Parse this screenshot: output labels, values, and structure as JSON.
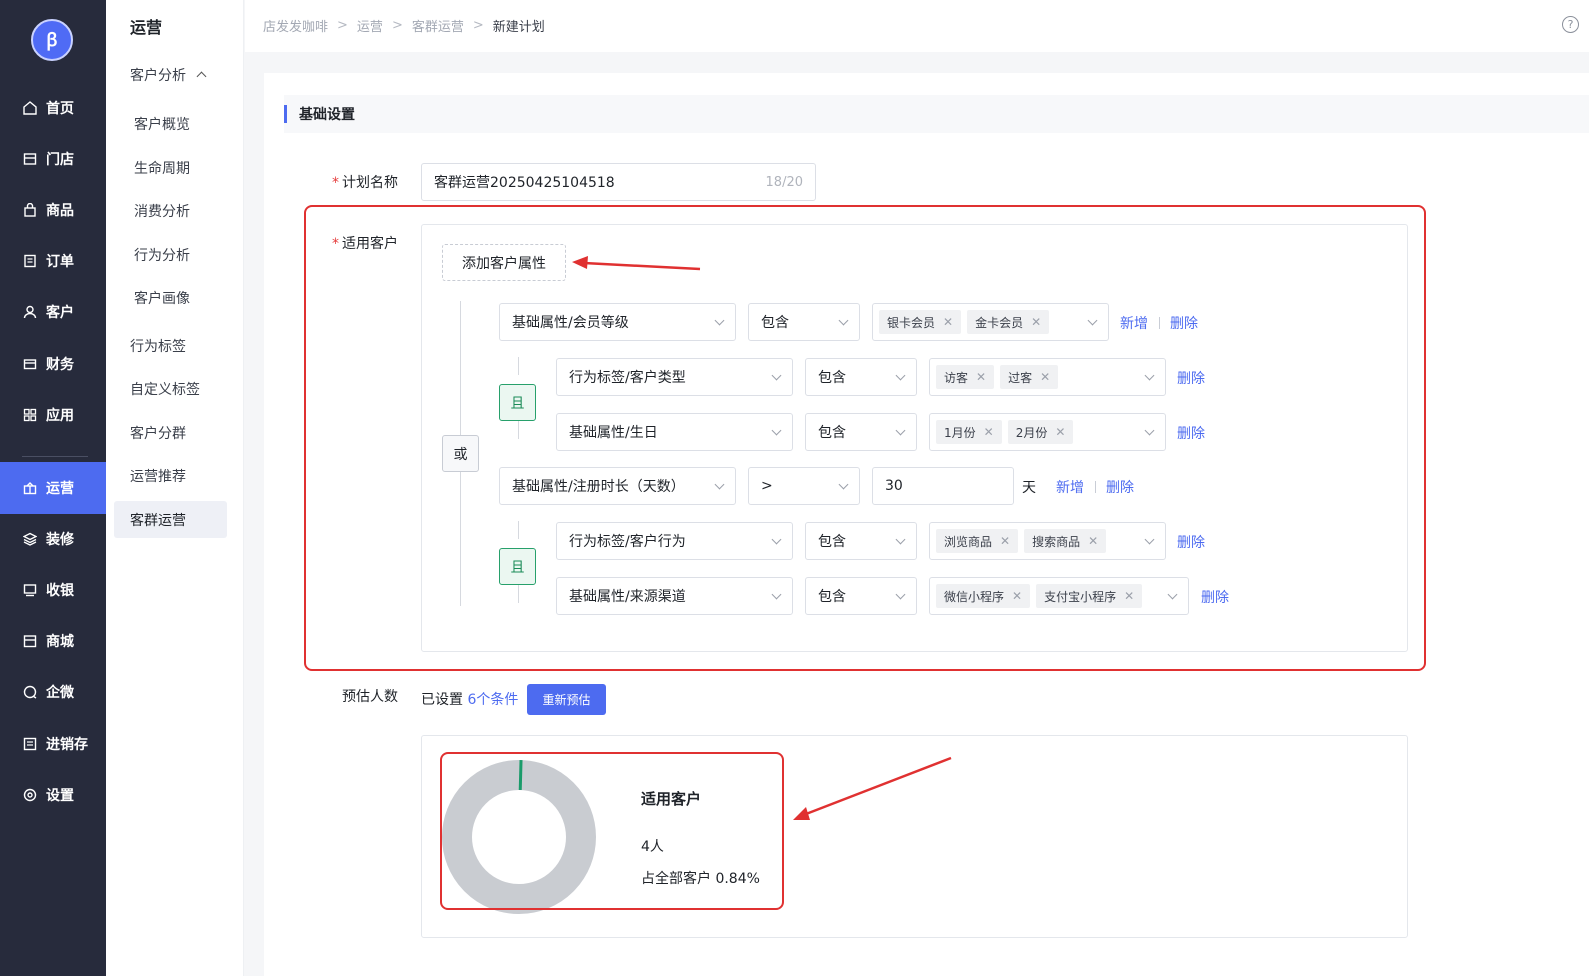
{
  "app": {
    "logo_text": "ꞵ"
  },
  "nav": {
    "items": [
      {
        "label": "首页",
        "icon": "home-icon"
      },
      {
        "label": "门店",
        "icon": "store-icon"
      },
      {
        "label": "商品",
        "icon": "bag-icon"
      },
      {
        "label": "订单",
        "icon": "order-icon"
      },
      {
        "label": "客户",
        "icon": "user-icon"
      },
      {
        "label": "财务",
        "icon": "wallet-icon"
      },
      {
        "label": "应用",
        "icon": "grid-icon"
      },
      {
        "label": "运营",
        "icon": "gift-icon"
      },
      {
        "label": "装修",
        "icon": "layers-icon"
      },
      {
        "label": "收银",
        "icon": "cashier-icon"
      },
      {
        "label": "商城",
        "icon": "mall-icon"
      },
      {
        "label": "企微",
        "icon": "chat-icon"
      },
      {
        "label": "进销存",
        "icon": "inventory-icon"
      },
      {
        "label": "设置",
        "icon": "gear-icon"
      }
    ]
  },
  "subnav": {
    "title": "运营",
    "group": "客户分析",
    "children": [
      "客户概览",
      "生命周期",
      "消费分析",
      "行为分析",
      "客户画像"
    ],
    "items": [
      "行为标签",
      "自定义标签",
      "客户分群",
      "运营推荐",
      "客群运营"
    ]
  },
  "breadcrumb": {
    "items": [
      "店发发咖啡",
      "运营",
      "客群运营"
    ],
    "current": "新建计划"
  },
  "section": {
    "title": "基础设置"
  },
  "form": {
    "plan_name_label": "计划名称",
    "plan_name_value": "客群运营20250425104518",
    "plan_name_counter": "18/20",
    "customers_label": "适用客户",
    "add_attr": "添加客户属性",
    "or_label": "或",
    "and_label": "且",
    "add_link": "新增",
    "delete_link": "删除",
    "day_unit": "天",
    "rows": {
      "r1": {
        "field": "基础属性/会员等级",
        "op": "包含",
        "tags": [
          "银卡会员",
          "金卡会员"
        ]
      },
      "r2": {
        "field": "行为标签/客户类型",
        "op": "包含",
        "tags": [
          "访客",
          "过客"
        ]
      },
      "r3": {
        "field": "基础属性/生日",
        "op": "包含",
        "tags": [
          "1月份",
          "2月份"
        ]
      },
      "r4": {
        "field": "基础属性/注册时长（天数）",
        "op": ">",
        "value": "30"
      },
      "r5": {
        "field": "行为标签/客户行为",
        "op": "包含",
        "tags": [
          "浏览商品",
          "搜索商品"
        ]
      },
      "r6": {
        "field": "基础属性/来源渠道",
        "op": "包含",
        "tags": [
          "微信小程序",
          "支付宝小程序"
        ]
      }
    },
    "estimate_label": "预估人数",
    "estimate_prefix": "已设置",
    "estimate_count": "6个条件",
    "re_estimate": "重新预估"
  },
  "result": {
    "title": "适用客户",
    "count": "4人",
    "share": "占全部客户 0.84%",
    "share_value": 0.84,
    "colors": {
      "ring": "#c9ccd1",
      "highlight": "#1a9b6a"
    }
  },
  "annotation_color": "#e03131"
}
